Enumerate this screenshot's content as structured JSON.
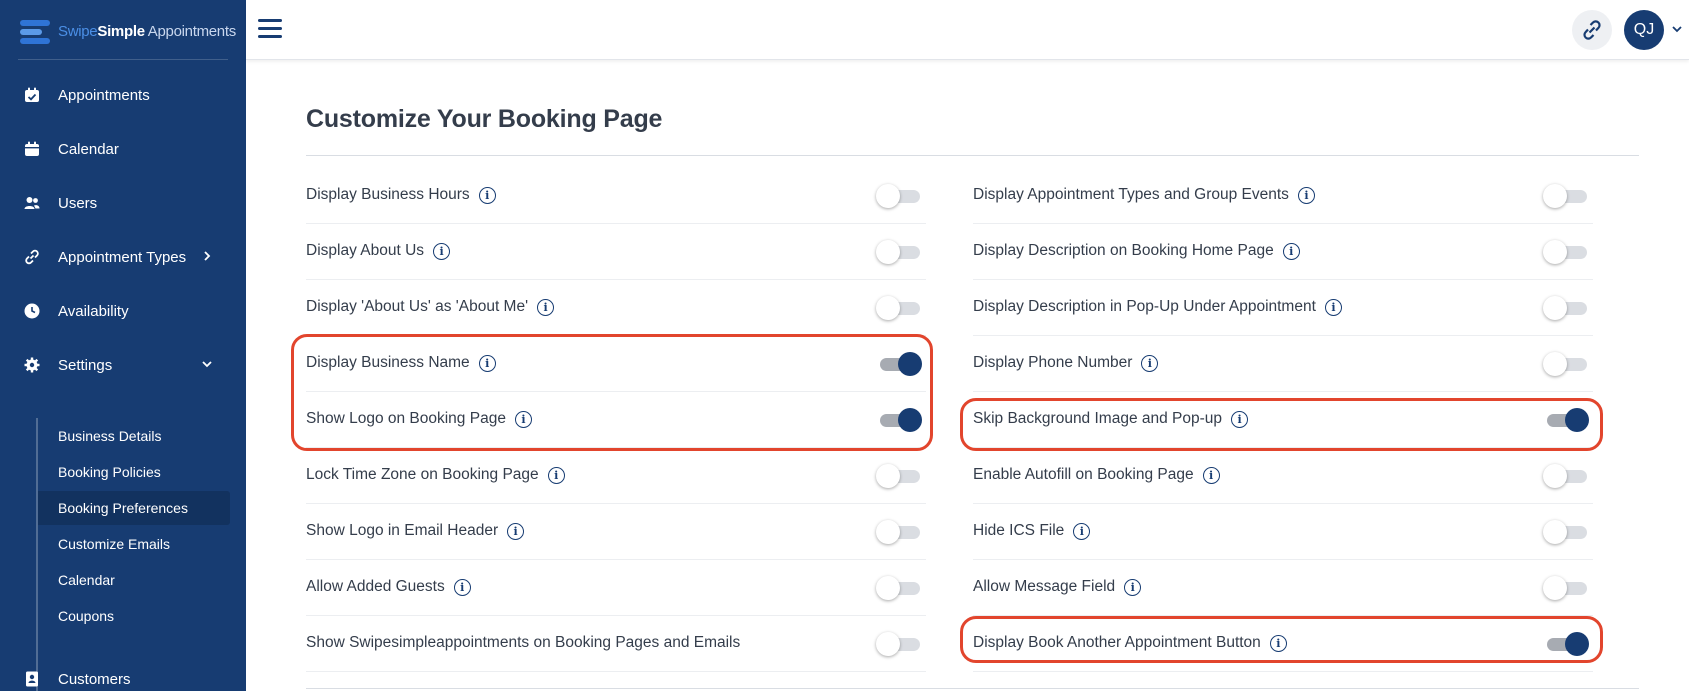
{
  "brand": {
    "part1": "Swipe",
    "part2": "Simple",
    "part3": " Appointments"
  },
  "sidebar": {
    "items": [
      {
        "label": "Appointments",
        "icon": "calendar-check-icon"
      },
      {
        "label": "Calendar",
        "icon": "calendar-icon"
      },
      {
        "label": "Users",
        "icon": "users-icon"
      },
      {
        "label": "Appointment Types",
        "icon": "link-icon",
        "chevron": "right"
      },
      {
        "label": "Availability",
        "icon": "clock-icon"
      },
      {
        "label": "Settings",
        "icon": "gear-icon",
        "chevron": "down"
      },
      {
        "label": "Customers",
        "icon": "contact-book-icon"
      }
    ],
    "settings_sub": [
      {
        "label": "Business Details"
      },
      {
        "label": "Booking Policies"
      },
      {
        "label": "Booking Preferences",
        "active": true
      },
      {
        "label": "Customize Emails"
      },
      {
        "label": "Calendar"
      },
      {
        "label": "Coupons"
      }
    ]
  },
  "header": {
    "avatar_initials": "QJ"
  },
  "page": {
    "title": "Customize Your Booking Page"
  },
  "settings": {
    "left": [
      {
        "label": "Display Business Hours",
        "info": true,
        "on": false
      },
      {
        "label": "Display About Us",
        "info": true,
        "on": false
      },
      {
        "label": "Display 'About Us' as 'About Me'",
        "info": true,
        "on": false
      },
      {
        "label": "Display Business Name",
        "info": true,
        "on": true
      },
      {
        "label": "Show Logo on Booking Page",
        "info": true,
        "on": true
      },
      {
        "label": "Lock Time Zone on Booking Page",
        "info": true,
        "on": false
      },
      {
        "label": "Show Logo in Email Header",
        "info": true,
        "on": false
      },
      {
        "label": "Allow Added Guests",
        "info": true,
        "on": false
      },
      {
        "label": "Show Swipesimpleappointments on Booking Pages and Emails",
        "info": false,
        "on": false
      }
    ],
    "right": [
      {
        "label": "Display Appointment Types and Group Events",
        "info": true,
        "on": false
      },
      {
        "label": "Display Description on Booking Home Page",
        "info": true,
        "on": false
      },
      {
        "label": "Display Description in Pop-Up Under Appointment",
        "info": true,
        "on": false
      },
      {
        "label": "Display Phone Number",
        "info": true,
        "on": false
      },
      {
        "label": "Skip Background Image and Pop-up",
        "info": true,
        "on": true
      },
      {
        "label": "Enable Autofill on Booking Page",
        "info": true,
        "on": false
      },
      {
        "label": "Hide ICS File",
        "info": true,
        "on": false
      },
      {
        "label": "Allow Message Field",
        "info": true,
        "on": false
      },
      {
        "label": "Display Book Another Appointment Button",
        "info": true,
        "on": true
      }
    ]
  },
  "colors": {
    "sidebar": "#173c72",
    "accent": "#173c72",
    "highlight": "#e2452d"
  }
}
